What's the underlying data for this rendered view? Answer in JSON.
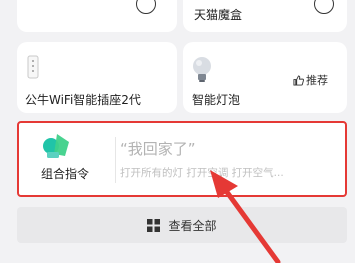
{
  "devices": [
    {
      "label": "",
      "icon": "device-icon"
    },
    {
      "label": "天猫魔盒",
      "icon": "device-icon"
    },
    {
      "label": "公牛WiFi智能插座2代",
      "icon": "smart-plug-icon"
    },
    {
      "label": "智能灯泡",
      "icon": "light-bulb-icon",
      "badge": "推荐"
    }
  ],
  "combo": {
    "label": "组合指令",
    "title": "“我回家了”",
    "subtitle": "打开所有的灯 打开空调 打开空气..."
  },
  "view_all": {
    "label": "查看全部"
  },
  "colors": {
    "highlight": "#e53935",
    "accent_teal": "#20c4a8",
    "accent_green": "#3fd18a"
  }
}
